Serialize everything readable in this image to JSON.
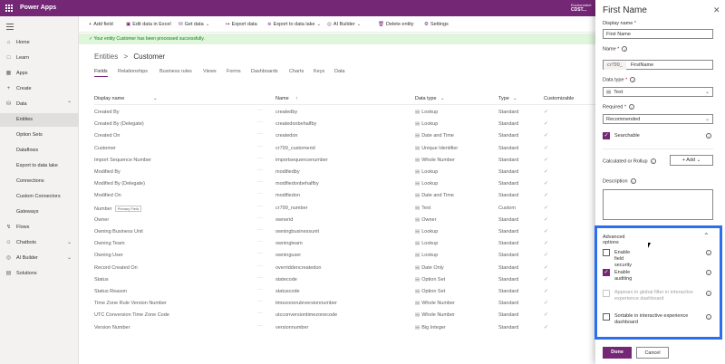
{
  "app": {
    "title": "Power Apps",
    "env_label": "Environment",
    "env_name": "CDST..."
  },
  "sidebar": {
    "items": [
      {
        "label": "Home",
        "icon": "home-icon",
        "glyph": "⌂"
      },
      {
        "label": "Learn",
        "icon": "book-icon",
        "glyph": "□"
      },
      {
        "label": "Apps",
        "icon": "apps-icon",
        "glyph": "▦"
      },
      {
        "label": "Create",
        "icon": "plus-icon",
        "glyph": "+"
      },
      {
        "label": "Data",
        "icon": "database-icon",
        "glyph": "⛁"
      },
      {
        "label": "Entities",
        "icon": "",
        "glyph": ""
      },
      {
        "label": "Option Sets",
        "icon": "",
        "glyph": ""
      },
      {
        "label": "Dataflows",
        "icon": "",
        "glyph": ""
      },
      {
        "label": "Export to data lake",
        "icon": "",
        "glyph": ""
      },
      {
        "label": "Connections",
        "icon": "",
        "glyph": ""
      },
      {
        "label": "Custom Connectors",
        "icon": "",
        "glyph": ""
      },
      {
        "label": "Gateways",
        "icon": "",
        "glyph": ""
      },
      {
        "label": "Flows",
        "icon": "flow-icon",
        "glyph": "↯"
      },
      {
        "label": "Chatbots",
        "icon": "chatbot-icon",
        "glyph": "☺"
      },
      {
        "label": "AI Builder",
        "icon": "ai-builder-icon",
        "glyph": "◎"
      },
      {
        "label": "Solutions",
        "icon": "solutions-icon",
        "glyph": "▤"
      }
    ]
  },
  "commands": {
    "add_field": "Add field",
    "edit_excel": "Edit data in Excel",
    "get_data": "Get data",
    "export_data": "Export data",
    "export_lake": "Export to data lake",
    "ai_builder": "AI Builder",
    "delete_entity": "Delete entity",
    "settings": "Settings"
  },
  "notice": "Your entity Customer has been processed successfully.",
  "breadcrumb": {
    "root": "Entities",
    "sep": ">",
    "current": "Customer"
  },
  "tabs": [
    "Fields",
    "Relationships",
    "Business rules",
    "Views",
    "Forms",
    "Dashboards",
    "Charts",
    "Keys",
    "Data"
  ],
  "table": {
    "headers": {
      "display_name": "Display name",
      "name": "Name",
      "data_type": "Data type",
      "type": "Type",
      "customizable": "Customizable"
    },
    "rows": [
      {
        "display": "Created By",
        "name": "createdby",
        "dtype": "Lookup",
        "type": "Standard",
        "badge": ""
      },
      {
        "display": "Created By (Delegate)",
        "name": "createdonbehalfby",
        "dtype": "Lookup",
        "type": "Standard",
        "badge": ""
      },
      {
        "display": "Created On",
        "name": "createdon",
        "dtype": "Date and Time",
        "type": "Standard",
        "badge": ""
      },
      {
        "display": "Customer",
        "name": "cr799_customerid",
        "dtype": "Unique Identifier",
        "type": "Standard",
        "badge": ""
      },
      {
        "display": "Import Sequence Number",
        "name": "importsequencenumber",
        "dtype": "Whole Number",
        "type": "Standard",
        "badge": ""
      },
      {
        "display": "Modified By",
        "name": "modifiedby",
        "dtype": "Lookup",
        "type": "Standard",
        "badge": ""
      },
      {
        "display": "Modified By (Delegate)",
        "name": "modifiedonbehalfby",
        "dtype": "Lookup",
        "type": "Standard",
        "badge": ""
      },
      {
        "display": "Modified On",
        "name": "modifiedon",
        "dtype": "Date and Time",
        "type": "Standard",
        "badge": ""
      },
      {
        "display": "Number",
        "name": "cr799_number",
        "dtype": "Text",
        "type": "Custom",
        "badge": "Primary Field"
      },
      {
        "display": "Owner",
        "name": "ownerid",
        "dtype": "Owner",
        "type": "Standard",
        "badge": ""
      },
      {
        "display": "Owning Business Unit",
        "name": "owningbusinessunit",
        "dtype": "Lookup",
        "type": "Standard",
        "badge": ""
      },
      {
        "display": "Owning Team",
        "name": "owningteam",
        "dtype": "Lookup",
        "type": "Standard",
        "badge": ""
      },
      {
        "display": "Owning User",
        "name": "owninguser",
        "dtype": "Lookup",
        "type": "Standard",
        "badge": ""
      },
      {
        "display": "Record Created On",
        "name": "overriddencreatedon",
        "dtype": "Date Only",
        "type": "Standard",
        "badge": ""
      },
      {
        "display": "Status",
        "name": "statecode",
        "dtype": "Option Set",
        "type": "Standard",
        "badge": ""
      },
      {
        "display": "Status Reason",
        "name": "statuscode",
        "dtype": "Option Set",
        "type": "Standard",
        "badge": ""
      },
      {
        "display": "Time Zone Rule Version Number",
        "name": "timezoneruleversionnumber",
        "dtype": "Whole Number",
        "type": "Standard",
        "badge": ""
      },
      {
        "display": "UTC Conversion Time Zone Code",
        "name": "utcconversiontimezonecode",
        "dtype": "Whole Number",
        "type": "Standard",
        "badge": ""
      },
      {
        "display": "Version Number",
        "name": "versionnumber",
        "dtype": "Big Integer",
        "type": "Standard",
        "badge": ""
      }
    ]
  },
  "panel": {
    "title": "First Name",
    "close": "✕",
    "display_name_label": "Display name",
    "display_name_value": "First Name",
    "name_label": "Name",
    "name_prefix": "cr799_",
    "name_value": "FirstName",
    "data_type_label": "Data type",
    "data_type_value": "Text",
    "required_label": "Required",
    "required_value": "Recommended",
    "searchable_label": "Searchable",
    "calc_label": "Calculated or Rollup",
    "add_label": "Add",
    "description_label": "Description",
    "advanced_label": "Advanced options",
    "opt_field_security": "Enable field security",
    "opt_auditing": "Enable auditing",
    "opt_global_filter": "Appears in global filter in interactive experience dashboard",
    "opt_sortable": "Sortable in interactive experience dashboard",
    "done": "Done",
    "cancel": "Cancel"
  },
  "colors": {
    "brand": "#742774",
    "highlight": "#2b6ff0",
    "success_bg": "#dff6dd"
  }
}
